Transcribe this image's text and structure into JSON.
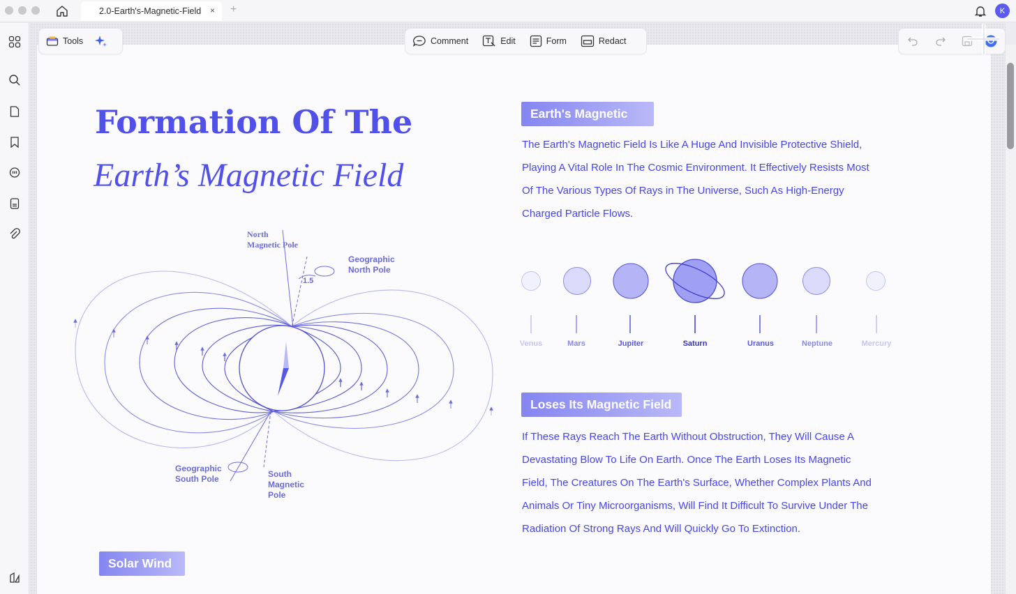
{
  "window": {
    "tab_title": "2.0-Earth's-Magnetic-Field",
    "tab_close": "×",
    "new_tab": "+",
    "avatar_initial": "K"
  },
  "toolbar": {
    "tools_label": "Tools",
    "comment_label": "Comment",
    "edit_label": "Edit",
    "form_label": "Form",
    "redact_label": "Redact"
  },
  "document": {
    "title_line1": "Formation Of The",
    "title_line2": "Earth’s Magnetic Field",
    "section1_heading": "Earth's Magnetic",
    "section1_lines": [
      "The Earth's Magnetic Field Is Like A Huge And Invisible Protective Shield,",
      "Playing A Vital Role In The Cosmic Environment. It Effectively Resists Most",
      "Of The Various Types Of Rays in The Universe, Such As High-Energy",
      "Charged Particle Flows."
    ],
    "planets": [
      "Venus",
      "Mars",
      "Jupiter",
      "Saturn",
      "Uranus",
      "Neptune",
      "Mercury"
    ],
    "section2_heading": "Loses Its Magnetic Field",
    "section2_lines": [
      "If These Rays Reach The Earth Without Obstruction, They Will Cause A",
      "Devastating Blow To Life On Earth. Once The Earth Loses Its Magnetic",
      "Field, The Creatures On The Earth's Surface, Whether Complex Plants And",
      "Animals Or Tiny Microorganisms, Will Find It Difficult To Survive Under The",
      "Radiation Of Strong Rays And Will Quickly Go To Extinction."
    ],
    "section3_heading": "Solar Wind",
    "diagram": {
      "north_magnetic_line1": "North",
      "north_magnetic_line2": "Magnetic Pole",
      "geo_north_line1": "Geographic",
      "geo_north_line2": "North Pole",
      "angle": "1.5",
      "geo_south_line1": "Geographic",
      "geo_south_line2": "South Pole",
      "south_mag_line1": "South",
      "south_mag_line2": "Magnetic",
      "south_mag_line3": "Pole"
    }
  },
  "colors": {
    "accent": "#5151ea",
    "text_blue": "#4646e8"
  }
}
